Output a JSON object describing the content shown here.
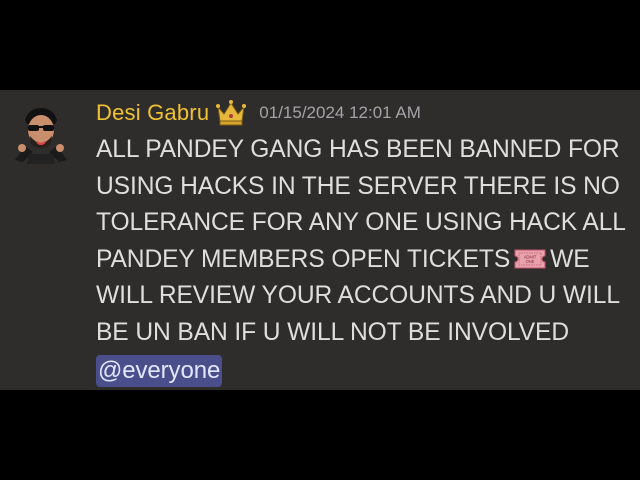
{
  "message": {
    "author": "Desi Gabru",
    "author_color": "#f0c232",
    "badge_icon": "crown-icon",
    "timestamp": "01/15/2024 12:01 AM",
    "lines": [
      "ALL PANDEY GANG HAS BEEN BANNED FOR",
      "USING HACKS IN THE SERVER THERE IS NO",
      "TOLERANCE FOR ANY ONE USING HACK ALL",
      "PANDEY MEMBERS  OPEN TICKETS",
      "WE",
      "WILL REVIEW YOUR ACCOUNTS AND U WILL",
      "BE UN BAN IF U WILL NOT BE INVOLVED"
    ],
    "ticket_emoji": "admission-ticket-icon",
    "ticket_text_1": "ADMIT",
    "ticket_text_2": "ONE",
    "mention": "@everyone"
  }
}
